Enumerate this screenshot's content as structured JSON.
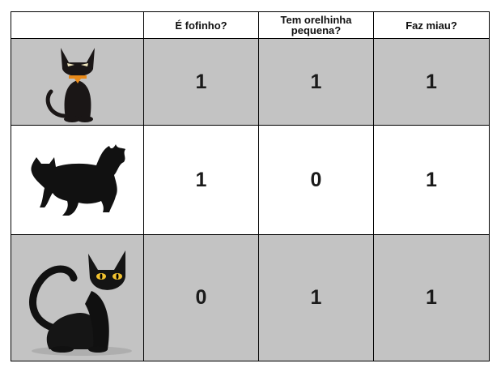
{
  "header": {
    "col1": "É fofinho?",
    "col2_line1": "Tem orelhinha",
    "col2_line2": "pequena?",
    "col3": "Faz miau?"
  },
  "rows": [
    {
      "image": "black-cat-sitting-cartoon-image",
      "fofinho": "1",
      "orelhinha": "1",
      "miau": "1"
    },
    {
      "image": "fluffy-cat-silhouette-image",
      "fofinho": "1",
      "orelhinha": "0",
      "miau": "1"
    },
    {
      "image": "black-cat-photo-image",
      "fofinho": "0",
      "orelhinha": "1",
      "miau": "1"
    }
  ],
  "colors": {
    "shaded_row": "#c3c3c3",
    "border": "#000000",
    "cat_eye": "#f2c230",
    "collar": "#e88a1a"
  }
}
